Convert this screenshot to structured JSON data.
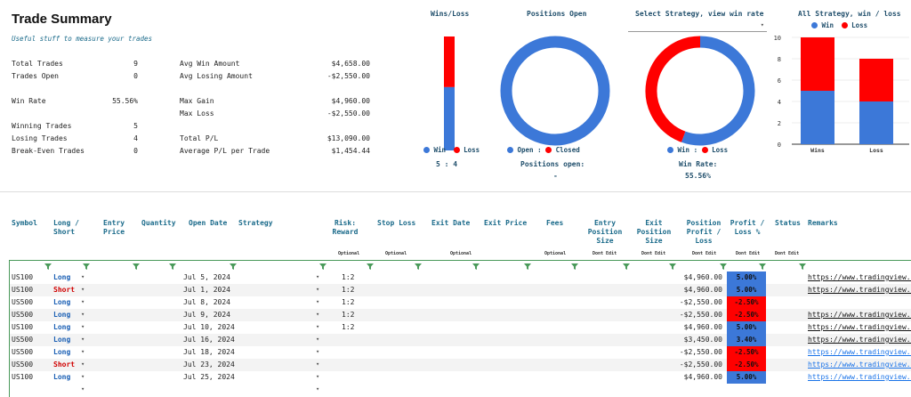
{
  "summary": {
    "title": "Trade Summary",
    "subtitle": "Useful stuff to measure your trades",
    "left_stats": [
      {
        "label": "Total Trades",
        "value": "9"
      },
      {
        "label": "Trades Open",
        "value": "0"
      },
      {
        "label": "Win Rate",
        "value": "55.56%"
      },
      {
        "label": "Winning Trades",
        "value": "5"
      },
      {
        "label": "Losing Trades",
        "value": "4"
      },
      {
        "label": "Break-Even Trades",
        "value": "0"
      }
    ],
    "right_stats": [
      {
        "label": "Avg Win Amount",
        "value": "$4,658.00"
      },
      {
        "label": "Avg Losing Amount",
        "value": "-$2,550.00"
      },
      {
        "label": "Max Gain",
        "value": "$4,960.00"
      },
      {
        "label": "Max Loss",
        "value": "-$2,550.00"
      },
      {
        "label": "Total P/L",
        "value": "$13,090.00"
      },
      {
        "label": "Average P/L per Trade",
        "value": "$1,454.44"
      }
    ]
  },
  "charts": {
    "wins_loss": {
      "title": "Wins/Loss",
      "legend_win": "Win",
      "legend_loss": "Loss",
      "ratio_text": "5 : 4"
    },
    "positions_open": {
      "title": "Positions Open",
      "legend_open": "Open",
      "legend_sep": ":",
      "legend_closed": "Closed",
      "caption": "Positions open:",
      "caption_value": "-"
    },
    "select_strategy": {
      "title": "Select Strategy, view win rate",
      "legend_win": "Win",
      "legend_sep": ":",
      "legend_loss": "Loss",
      "caption": "Win Rate:",
      "caption_value": "55.56%"
    },
    "all_strategy": {
      "title": "All Strategy, win / loss",
      "legend_win": "Win",
      "legend_loss": "Loss"
    }
  },
  "colors": {
    "win": "#3c78d8",
    "loss": "#ff0000",
    "header": "#1a6a8a"
  },
  "chart_data": [
    {
      "type": "bar",
      "title": "Wins/Loss",
      "categories": [
        ""
      ],
      "series": [
        {
          "name": "Win",
          "values": [
            5
          ]
        },
        {
          "name": "Loss",
          "values": [
            4
          ]
        }
      ],
      "stacked": true
    },
    {
      "type": "pie",
      "title": "Positions Open",
      "labels": [
        "Open",
        "Closed"
      ],
      "values": [
        0,
        9
      ],
      "donut": true
    },
    {
      "type": "pie",
      "title": "Select Strategy, view win rate",
      "labels": [
        "Win",
        "Loss"
      ],
      "values": [
        5,
        4
      ],
      "donut": true
    },
    {
      "type": "bar",
      "title": "All Strategy, win / loss",
      "categories": [
        "Wins",
        "Loss"
      ],
      "series": [
        {
          "name": "Win",
          "values": [
            5,
            4
          ]
        },
        {
          "name": "Loss",
          "values": [
            5,
            4
          ]
        }
      ],
      "stacked": true,
      "ylim": [
        0,
        10
      ],
      "yticks": [
        "10",
        "8",
        "6",
        "4",
        "2",
        "0"
      ]
    }
  ],
  "table": {
    "headers": {
      "symbol": "Symbol",
      "long_short_1": "Long /",
      "long_short_2": "Short",
      "entry_1": "Entry",
      "entry_2": "Price",
      "quantity": "Quantity",
      "open_date": "Open Date",
      "strategy": "Strategy",
      "rr_1": "Risk:",
      "rr_2": "Reward",
      "stop_loss": "Stop Loss",
      "exit_date": "Exit Date",
      "exit_price": "Exit Price",
      "fees": "Fees",
      "eps_1": "Entry",
      "eps_2": "Position",
      "eps_3": "Size",
      "xps_1": "Exit",
      "xps_2": "Position",
      "xps_3": "Size",
      "ppl_1": "Position",
      "ppl_2": "Profit /",
      "ppl_3": "Loss",
      "pl_1": "Profit /",
      "pl_2": "Loss %",
      "status": "Status",
      "remarks": "Remarks"
    },
    "subheaders": {
      "optional_1": "Optional",
      "optional_2": "Optional",
      "optional_3": "Optional",
      "optional_4": "Optional",
      "dont_1": "Dont Edit",
      "dont_2": "Dont Edit",
      "dont_3": "Dont Edit",
      "dont_4": "Dont Edit",
      "dont_5": "Dont Edit"
    },
    "rows": [
      {
        "symbol": "US100",
        "side": "Long",
        "open_date": "Jul 5, 2024",
        "rr": "1:2",
        "pl": "$4,960.00",
        "pct": "5.00%",
        "remarks": "https://www.tradingview.c"
      },
      {
        "symbol": "US100",
        "side": "Short",
        "open_date": "Jul 1, 2024",
        "rr": "1:2",
        "pl": "$4,960.00",
        "pct": "5.00%",
        "remarks": "https://www.tradingview.c"
      },
      {
        "symbol": "US500",
        "side": "Long",
        "open_date": "Jul 8, 2024",
        "rr": "1:2",
        "pl": "-$2,550.00",
        "pct": "-2.50%",
        "remarks": ""
      },
      {
        "symbol": "US500",
        "side": "Long",
        "open_date": "Jul 9, 2024",
        "rr": "1:2",
        "pl": "-$2,550.00",
        "pct": "-2.50%",
        "remarks": "https://www.tradingview.c"
      },
      {
        "symbol": "US100",
        "side": "Long",
        "open_date": "Jul 10, 2024",
        "rr": "1:2",
        "pl": "$4,960.00",
        "pct": "5.00%",
        "remarks": "https://www.tradingview.c"
      },
      {
        "symbol": "US500",
        "side": "Long",
        "open_date": "Jul 16, 2024",
        "rr": "",
        "pl": "$3,450.00",
        "pct": "3.40%",
        "remarks": "https://www.tradingview.c"
      },
      {
        "symbol": "US500",
        "side": "Long",
        "open_date": "Jul 18, 2024",
        "rr": "",
        "pl": "-$2,550.00",
        "pct": "-2.50%",
        "remarks": "https://www.tradingview.c"
      },
      {
        "symbol": "US500",
        "side": "Short",
        "open_date": "Jul 23, 2024",
        "rr": "",
        "pl": "-$2,550.00",
        "pct": "-2.50%",
        "remarks": "https://www.tradingview.c"
      },
      {
        "symbol": "US100",
        "side": "Long",
        "open_date": "Jul 25, 2024",
        "rr": "",
        "pl": "$4,960.00",
        "pct": "5.00%",
        "remarks": "https://www.tradingview.c"
      }
    ]
  }
}
